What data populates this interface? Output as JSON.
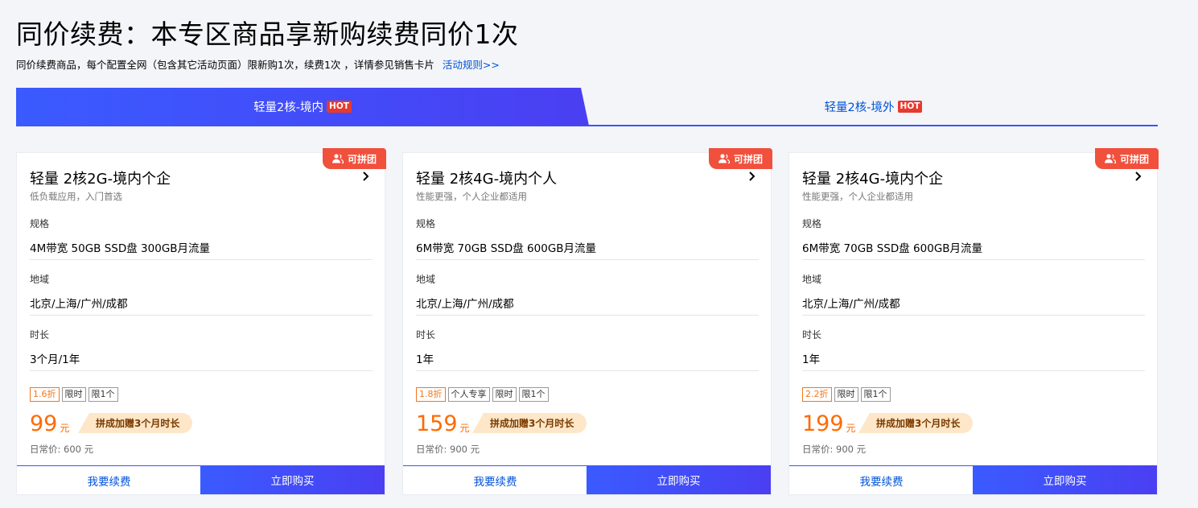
{
  "header": {
    "title": "同价续费：本专区商品享新购续费同价1次",
    "subtitle": "同价续费商品，每个配置全网（包含其它活动页面）限新购1次，续费1次 ，详情参见销售卡片",
    "rules_link": "活动规则>>"
  },
  "tabs": [
    {
      "label": "轻量2核-境内",
      "badge": "HOT",
      "active": true
    },
    {
      "label": "轻量2核-境外",
      "badge": "HOT",
      "active": false
    }
  ],
  "labels": {
    "spec": "规格",
    "region": "地域",
    "duration": "时长",
    "price_unit": "元",
    "renew_button": "我要续费",
    "buy_button": "立即购买",
    "group_badge": "可拼团"
  },
  "cards": [
    {
      "title": "轻量 2核2G-境内个企",
      "desc": "低负载应用，入门首选",
      "spec": "4M带宽 50GB SSD盘 300GB月流量",
      "region": "北京/上海/广州/成都",
      "duration": "3个月/1年",
      "tags": [
        "1.6折",
        "限时",
        "限1个"
      ],
      "price": "99",
      "bonus": "拼成加赠3个月时长",
      "daily_price": "日常价: 600 元"
    },
    {
      "title": "轻量 2核4G-境内个人",
      "desc": "性能更强，个人企业都适用",
      "spec": "6M带宽 70GB SSD盘 600GB月流量",
      "region": "北京/上海/广州/成都",
      "duration": "1年",
      "tags": [
        "1.8折",
        "个人专享",
        "限时",
        "限1个"
      ],
      "price": "159",
      "bonus": "拼成加赠3个月时长",
      "daily_price": "日常价: 900 元"
    },
    {
      "title": "轻量 2核4G-境内个企",
      "desc": "性能更强，个人企业都适用",
      "spec": "6M带宽 70GB SSD盘 600GB月流量",
      "region": "北京/上海/广州/成都",
      "duration": "1年",
      "tags": [
        "2.2折",
        "限时",
        "限1个"
      ],
      "price": "199",
      "bonus": "拼成加赠3个月时长",
      "daily_price": "日常价: 900 元"
    }
  ],
  "colors": {
    "accent": "#3d52ff",
    "link": "#0052d9",
    "price": "#ff6a00",
    "hot": "#e8392e",
    "group_badge": "#f0503c"
  },
  "icons": {
    "group": "people-icon",
    "chevron": "chevron-right-icon"
  }
}
